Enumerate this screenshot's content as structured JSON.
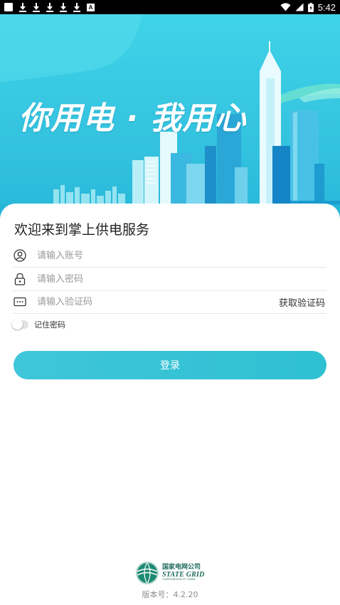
{
  "status_bar": {
    "time": "5:42",
    "left_icons": [
      "square-notification-icon",
      "download-icon",
      "download-icon",
      "download-icon",
      "download-icon",
      "download-icon",
      "a-notification-icon"
    ],
    "a_glyph": "A",
    "right_icons": [
      "wifi-icon",
      "signal-icon",
      "battery-icon"
    ]
  },
  "banner": {
    "slogan": "你用电 · 我用心",
    "colors": {
      "sky_top": "#3fd3e8",
      "sky_bottom": "#28b6d8",
      "building": "#2aa7d6"
    }
  },
  "login": {
    "welcome": "欢迎来到掌上供电服务",
    "account_placeholder": "请输入账号",
    "password_placeholder": "请输入密码",
    "code_placeholder": "请输入验证码",
    "get_code": "获取验证码",
    "remember_password": "记住密码",
    "remember_checked": false,
    "login_button": "登录",
    "accent_color": "#3fc6d9"
  },
  "footer": {
    "logo_cn": "国家电网公司",
    "logo_en": "STATE GRID",
    "logo_sub": "CORPORATION OF CHINA",
    "version": "版本号：4.2.20"
  }
}
